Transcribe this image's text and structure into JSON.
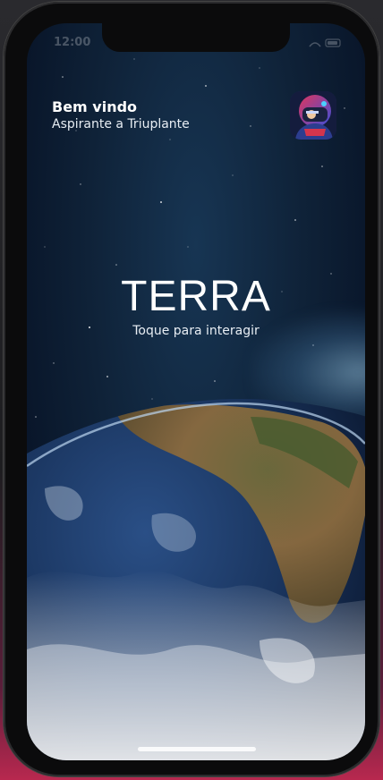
{
  "status_bar": {
    "time": "12:00"
  },
  "header": {
    "title": "Bem vindo",
    "subtitle": "Aspirante a Triuplante",
    "avatar_icon": "astronaut-avatar-icon"
  },
  "planet": {
    "name": "TERRA",
    "hint": "Toque para interagir"
  },
  "colors": {
    "background": "#0f2238",
    "ocean": "#1c3a6a",
    "land": "#7a6a3a",
    "text": "#ffffff"
  }
}
